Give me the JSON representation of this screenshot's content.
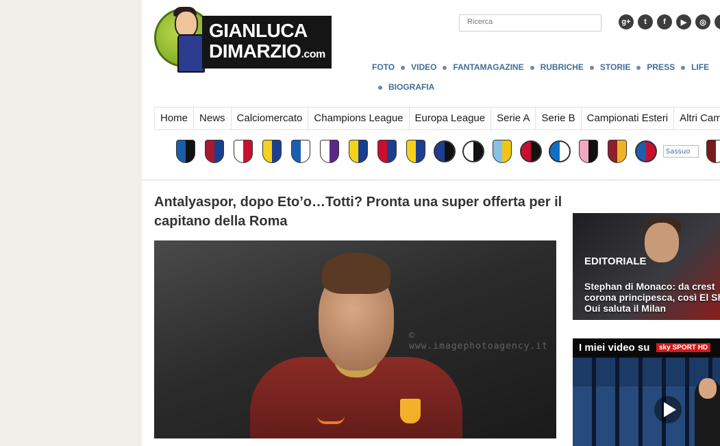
{
  "logo": {
    "line1": "GIANLUCA",
    "line2": "DIMARZIO",
    "suffix": ".com"
  },
  "search": {
    "placeholder": "Ricerca"
  },
  "social": [
    {
      "icon": "google-plus-icon",
      "glyph": "g+"
    },
    {
      "icon": "twitter-icon",
      "glyph": "t"
    },
    {
      "icon": "facebook-icon",
      "glyph": "f"
    },
    {
      "icon": "youtube-icon",
      "glyph": "▶"
    },
    {
      "icon": "instagram-icon",
      "glyph": "◎"
    },
    {
      "icon": "more-social-icon",
      "glyph": ""
    }
  ],
  "topnav": [
    "FOTO",
    "VIDEO",
    "FANTAMAGAZINE",
    "RUBRICHE",
    "STORIE",
    "PRESS",
    "LIFE",
    "BIOGRAFIA"
  ],
  "mainnav": [
    "Home",
    "News",
    "Calciomercato",
    "Champions League",
    "Europa League",
    "Serie A",
    "Serie B",
    "Campionati Esteri",
    "Altri Cam"
  ],
  "crests": [
    {
      "name": "atalanta",
      "color": "#1b5fa8",
      "color2": "#111111",
      "round": false
    },
    {
      "name": "bologna",
      "color": "#a6192e",
      "color2": "#1b3f8f",
      "round": false
    },
    {
      "name": "carpi",
      "color": "#ffffff",
      "color2": "#c8102e",
      "round": false
    },
    {
      "name": "chievo",
      "color": "#f6d21b",
      "color2": "#1b3f8f",
      "round": false
    },
    {
      "name": "empoli",
      "color": "#1c5fb0",
      "color2": "#ffffff",
      "round": false
    },
    {
      "name": "fiorentina",
      "color": "#ffffff",
      "color2": "#5b2a86",
      "round": false
    },
    {
      "name": "frosinone",
      "color": "#f6d21b",
      "color2": "#1b3f8f",
      "round": false
    },
    {
      "name": "genoa",
      "color": "#c8102e",
      "color2": "#1b3f8f",
      "round": false
    },
    {
      "name": "verona",
      "color": "#f6d21b",
      "color2": "#1b3f8f",
      "round": false
    },
    {
      "name": "inter",
      "color": "#1c3f94",
      "color2": "#111111",
      "round": true
    },
    {
      "name": "juventus",
      "color": "#ffffff",
      "color2": "#111111",
      "round": true
    },
    {
      "name": "lazio",
      "color": "#87c1e6",
      "color2": "#f0c419",
      "round": false
    },
    {
      "name": "milan",
      "color": "#c8102e",
      "color2": "#111111",
      "round": true
    },
    {
      "name": "napoli",
      "color": "#0f6fc6",
      "color2": "#ffffff",
      "round": true
    },
    {
      "name": "palermo",
      "color": "#f2a8c0",
      "color2": "#111111",
      "round": false
    },
    {
      "name": "roma",
      "color": "#8e1f2f",
      "color2": "#f0b323",
      "round": false
    },
    {
      "name": "sampdoria",
      "color": "#1b5fb0",
      "color2": "#c8102e",
      "round": true
    }
  ],
  "broken_crest": "Sassuo",
  "crests_after": [
    {
      "name": "torino",
      "color": "#7a1a1a",
      "color2": "#ffffff",
      "round": false
    }
  ],
  "article": {
    "title": "Antalyaspor, dopo Eto’o…Totti? Pronta una super offerta per il capitano della Roma",
    "watermark": "© www.imagephotoagency.it"
  },
  "sidebar": {
    "editorial_label": "EDITORIALE",
    "editorial_text": "Stephan di Monaco: da crest corona principesca, così El Sh Oui saluta il Milan",
    "video_title": "I miei video su",
    "video_badge": "sky SPORT HD"
  }
}
